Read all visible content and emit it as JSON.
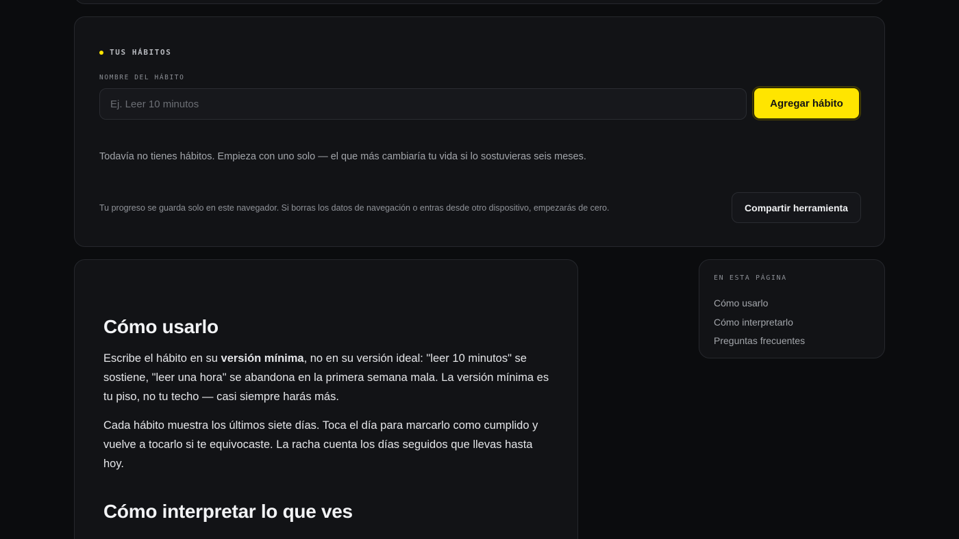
{
  "habits": {
    "section_label": "TUS HÁBITOS",
    "field_label": "NOMBRE DEL HÁBITO",
    "input_placeholder": "Ej. Leer 10 minutos",
    "input_value": "",
    "add_button": "Agregar hábito",
    "empty_state": "Todavía no tienes hábitos. Empieza con uno solo — el que más cambiaría tu vida si lo sostuvieras seis meses.",
    "storage_note": "Tu progreso se guarda solo en este navegador. Si borras los datos de navegación o entras desde otro dispositivo, empezarás de cero.",
    "share_button": "Compartir herramienta"
  },
  "article": {
    "h1": "Cómo usarlo",
    "p1_before": "Escribe el hábito en su ",
    "p1_bold": "versión mínima",
    "p1_after": ", no en su versión ideal: \"leer 10 minutos\" se sostiene, \"leer una hora\" se abandona en la primera semana mala. La versión mínima es tu piso, no tu techo — casi siempre harás más.",
    "p2": "Cada hábito muestra los últimos siete días. Toca el día para marcarlo como cumplido y vuelve a tocarlo si te equivocaste. La racha cuenta los días seguidos que llevas hasta hoy.",
    "h2": "Cómo interpretar lo que ves"
  },
  "toc": {
    "title": "EN ESTA PÁGINA",
    "items": [
      "Cómo usarlo",
      "Cómo interpretarlo",
      "Preguntas frecuentes"
    ]
  },
  "colors": {
    "accent": "#ffe500",
    "background": "#0b0c0e",
    "card": "#121316"
  }
}
